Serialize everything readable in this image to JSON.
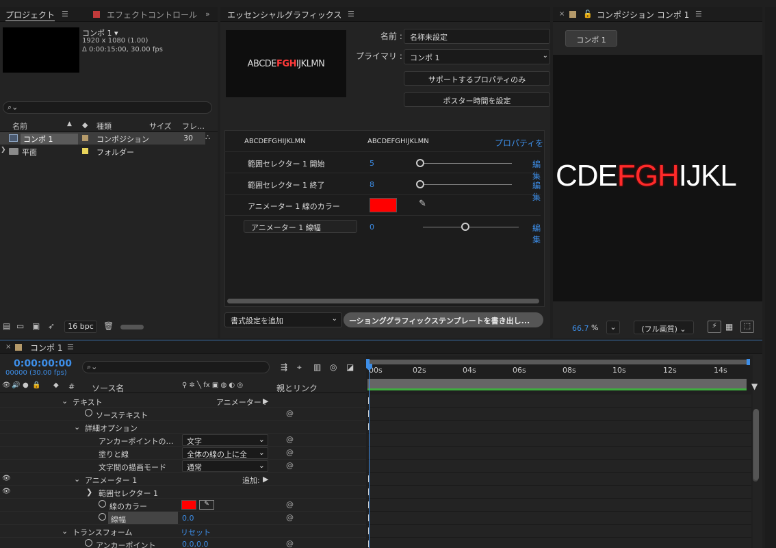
{
  "project": {
    "tab_label": "プロジェクト",
    "effect_tab_label": "エフェクトコントロール",
    "comp_name": "コンポ 1 ▾",
    "comp_size": "1920 x 1080 (1.00)",
    "comp_duration": "Δ 0:00:15:00, 30.00 fps",
    "search_placeholder": "",
    "col_name": "名前",
    "col_type": "種類",
    "col_size": "サイズ",
    "col_frame": "フレ…",
    "items": [
      {
        "name": "コンポ 1",
        "type": "コンポジション",
        "frames": "30",
        "color": "#b59a6a"
      },
      {
        "name": "平面",
        "type": "フォルダー",
        "frames": "",
        "color": "#e8d45a"
      }
    ],
    "bpc": "16 bpc"
  },
  "essential": {
    "tab_label": "エッセンシャルグラフィックス",
    "preview_text_left": "ABCDE",
    "preview_text_mid": "FGH",
    "preview_text_right": "IJKLMN",
    "name_label": "名前 :",
    "name_value": "名称未設定",
    "primary_label": "プライマリ :",
    "primary_value": "コンポ 1",
    "supported_only_button": "サポートするプロパティのみ",
    "poster_time_button": "ポスター時間を設定",
    "props_header_left": "ABCDEFGHIJKLMN",
    "props_header_mid": "ABCDEFGHIJKLMN",
    "props_header_right": "プロパティを",
    "props": [
      {
        "label": "範囲セレクター 1 開始",
        "value": "5",
        "edit": "編集"
      },
      {
        "label": "範囲セレクター 1 終了",
        "value": "8",
        "edit": "編集"
      },
      {
        "label": "アニメーター 1 線のカラー",
        "value": "",
        "edit": ""
      },
      {
        "label": "アニメーター 1 線幅",
        "value": "0",
        "edit": "編集"
      }
    ],
    "stroke_color": "#ff0000",
    "add_format_label": "書式設定を追加",
    "export_button": "ーションググラフィックステンプレートを書き出し..."
  },
  "composition": {
    "tab_label": "コンポジション コンポ 1",
    "sub_tab": "コンポ 1",
    "canvas_left": "CDE",
    "canvas_mid": "FGH",
    "canvas_right": "IJKL",
    "zoom": "66.7",
    "zoom_unit": "%",
    "quality": "(フル画質)"
  },
  "timeline": {
    "tab_label": "コンポ 1",
    "timecode": "0:00:00:00",
    "frame_info": "00000 (30.00 fps)",
    "col_source": "ソース名",
    "col_parent": "親とリンク",
    "col_hash": "#",
    "ruler": [
      "00s",
      "02s",
      "04s",
      "06s",
      "08s",
      "10s",
      "12s",
      "14s"
    ],
    "rows": [
      {
        "label": "テキスト",
        "extra": "アニメーター :",
        "kind": "group"
      },
      {
        "label": "ソーステキスト",
        "kind": "prop"
      },
      {
        "label": "詳細オプション",
        "kind": "group"
      },
      {
        "label": "アンカーポイントの…",
        "dropdown": "文字",
        "kind": "dd"
      },
      {
        "label": "塗りと線",
        "dropdown": "全体の線の上に全",
        "kind": "dd"
      },
      {
        "label": "文字間の描画モード",
        "dropdown": "通常",
        "kind": "dd"
      },
      {
        "label": "アニメーター 1",
        "extra": "追加:",
        "kind": "group"
      },
      {
        "label": "範囲セレクター 1",
        "kind": "group"
      },
      {
        "label": "線のカラー",
        "kind": "color"
      },
      {
        "label": "線幅",
        "value": "0.0",
        "kind": "value"
      },
      {
        "label": "トランスフォーム",
        "value": "リセット",
        "kind": "group"
      },
      {
        "label": "アンカーポイント",
        "value": "0.0,0.0",
        "kind": "value"
      }
    ]
  }
}
